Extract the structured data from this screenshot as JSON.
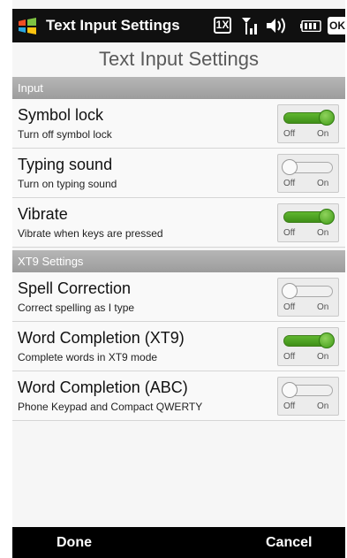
{
  "statusbar": {
    "title": "Text Input Settings",
    "network_label": "1X",
    "ok_label": "OK",
    "icons": [
      "windows-logo-icon",
      "signal-icon",
      "volume-icon",
      "battery-icon"
    ]
  },
  "page_title": "Text Input Settings",
  "sections": [
    {
      "label": "Input",
      "items": [
        {
          "title": "Symbol lock",
          "subtitle": "Turn off symbol lock",
          "on": true
        },
        {
          "title": "Typing sound",
          "subtitle": "Turn on typing sound",
          "on": false
        },
        {
          "title": "Vibrate",
          "subtitle": "Vibrate when keys are pressed",
          "on": true
        }
      ]
    },
    {
      "label": "XT9 Settings",
      "items": [
        {
          "title": "Spell Correction",
          "subtitle": "Correct spelling as I type",
          "on": false
        },
        {
          "title": "Word Completion (XT9)",
          "subtitle": "Complete words in XT9 mode",
          "on": true
        },
        {
          "title": "Word Completion (ABC)",
          "subtitle": "Phone Keypad and Compact QWERTY",
          "on": false
        }
      ]
    }
  ],
  "toggle_labels": {
    "off": "Off",
    "on": "On"
  },
  "bottom_bar": {
    "left": "Done",
    "right": "Cancel"
  },
  "colors": {
    "toggle_on": "#4da021",
    "section_bg": "#a8a8a8",
    "bar_bg": "#000000"
  }
}
